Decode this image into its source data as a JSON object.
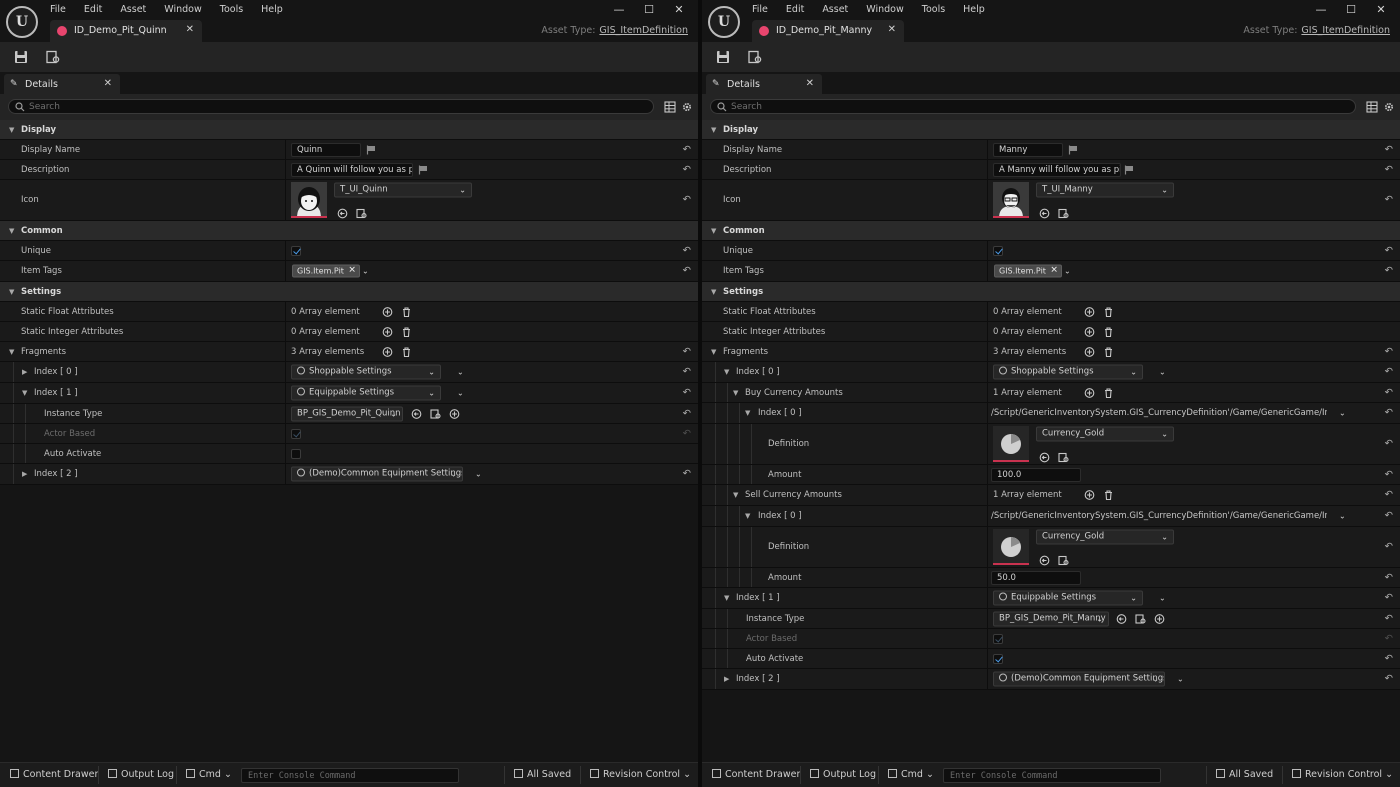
{
  "menus": [
    "File",
    "Edit",
    "Asset",
    "Window",
    "Tools",
    "Help"
  ],
  "window_controls": {
    "minimize": "—",
    "maximize": "☐",
    "close": "✕"
  },
  "logo_text": "U",
  "asset_type_label": "Asset Type:",
  "asset_type_value": "GIS_ItemDefinition",
  "details_tab": "Details",
  "search_placeholder": "Search",
  "categories": {
    "display": "Display",
    "common": "Common",
    "settings": "Settings"
  },
  "labels": {
    "display_name": "Display Name",
    "description": "Description",
    "icon": "Icon",
    "unique": "Unique",
    "item_tags": "Item Tags",
    "static_float": "Static Float Attributes",
    "static_integer": "Static Integer Attributes",
    "fragments": "Fragments",
    "index0": "Index [ 0 ]",
    "index1": "Index [ 1 ]",
    "index2": "Index [ 2 ]",
    "instance_type": "Instance Type",
    "actor_based": "Actor Based",
    "auto_activate": "Auto Activate",
    "buy_currency": "Buy Currency Amounts",
    "sell_currency": "Sell Currency Amounts",
    "definition": "Definition",
    "amount": "Amount"
  },
  "values": {
    "zero_array": "0 Array element",
    "three_array": "3 Array elements",
    "one_array": "1 Array element",
    "shoppable": "Shoppable Settings",
    "equippable": "Equippable Settings",
    "common_equipment": "(Demo)Common Equipment Settings",
    "tag": "GIS.Item.Pit",
    "currency_path": "/Script/GenericInventorySystem.GIS_CurrencyDefinition'/Game/GenericGame/InventorySys",
    "currency_gold": "Currency_Gold"
  },
  "statusbar": {
    "content_drawer": "Content Drawer",
    "output_log": "Output Log",
    "cmd": "Cmd",
    "console_placeholder": "Enter Console Command",
    "all_saved": "All Saved",
    "revision_control": "Revision Control"
  },
  "left": {
    "tab_title": "ID_Demo_Pit_Quinn",
    "display_name": "Quinn",
    "description": "A Quinn will follow you as pit",
    "icon_texture": "T_UI_Quinn",
    "unique_checked": true,
    "instance_type": "BP_GIS_Demo_Pit_Quinn",
    "actor_based_checked": true,
    "auto_activate_checked": false
  },
  "right": {
    "tab_title": "ID_Demo_Pit_Manny",
    "display_name": "Manny",
    "description": "A Manny will follow you as pit",
    "icon_texture": "T_UI_Manny",
    "unique_checked": true,
    "buy_amount": "100.0",
    "sell_amount": "50.0",
    "instance_type": "BP_GIS_Demo_Pit_Manny",
    "actor_based_checked": true,
    "auto_activate_checked": true
  },
  "colors": {
    "accent": "#4a9be8",
    "asset_pink": "#e8456e",
    "thumb_border": "#c9324f"
  }
}
